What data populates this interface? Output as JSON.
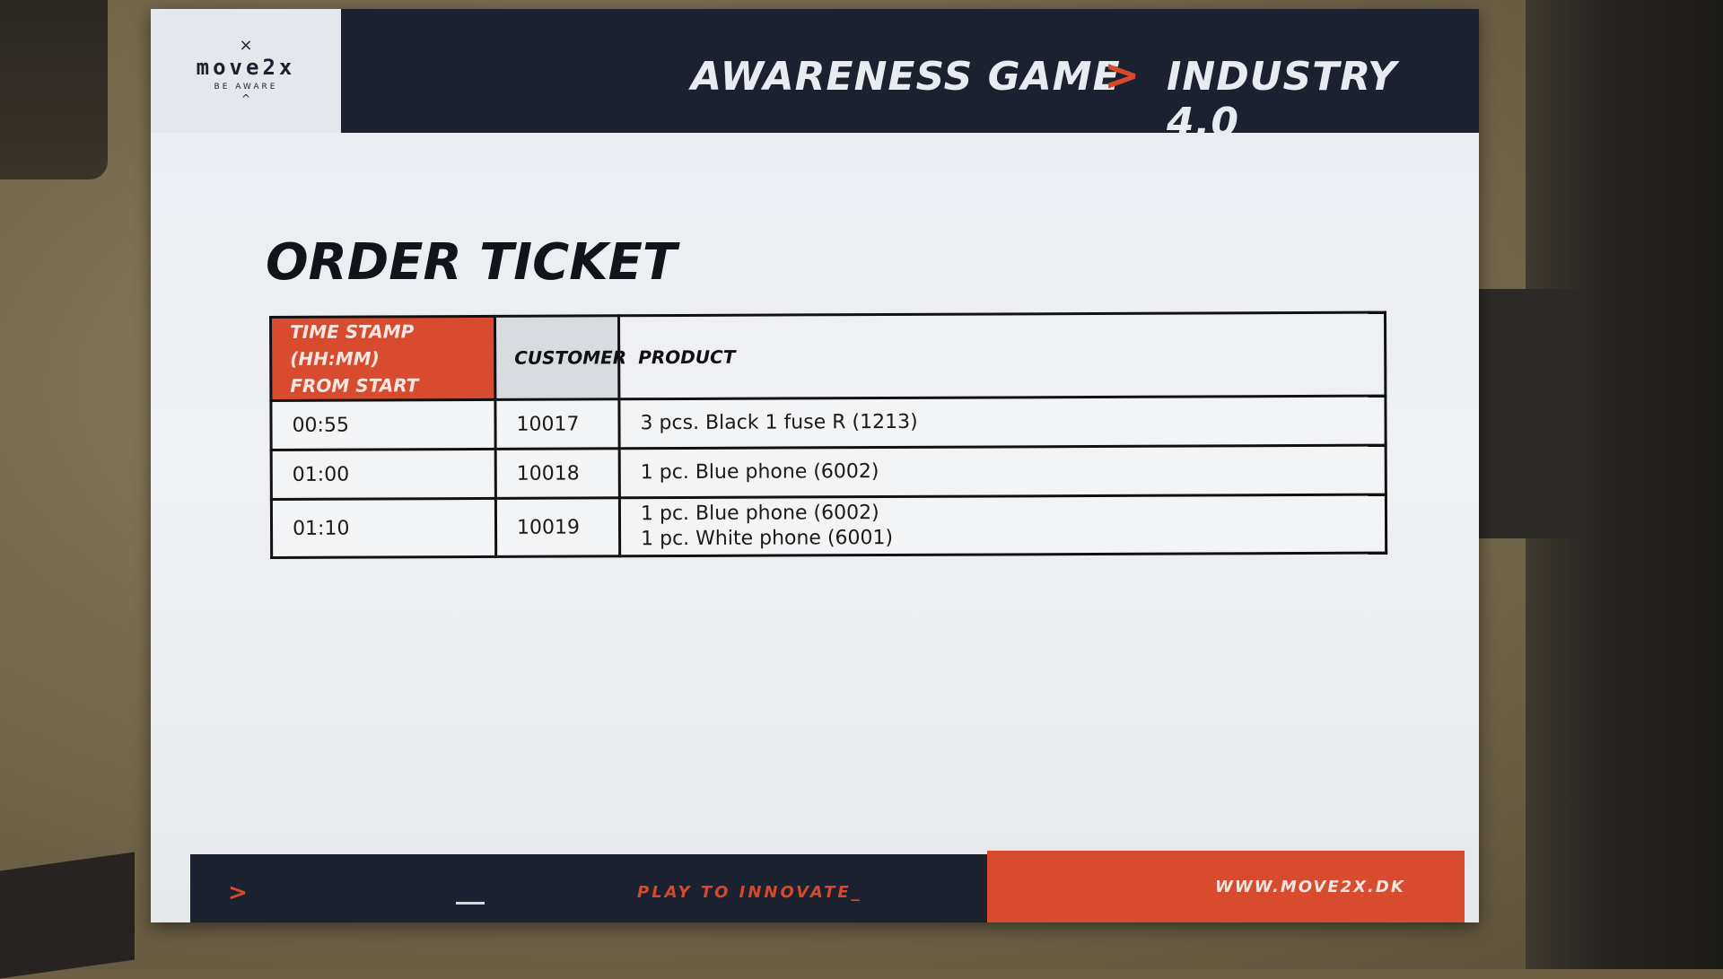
{
  "logo": {
    "mark": "×",
    "word": "move2x",
    "tagline": "BE AWARE",
    "caret": "^"
  },
  "header": {
    "left": "AWARENESS GAME",
    "separator": ">",
    "right": "INDUSTRY 4.0"
  },
  "title": "ORDER TICKET",
  "table": {
    "headers": {
      "time_line1": "TIME STAMP (HH:MM)",
      "time_line2": "FROM START",
      "customer": "CUSTOMER",
      "product": "PRODUCT"
    },
    "rows": [
      {
        "time": "00:55",
        "customer": "10017",
        "products": [
          "3 pcs. Black 1 fuse R (1213)"
        ]
      },
      {
        "time": "01:00",
        "customer": "10018",
        "products": [
          "1 pc. Blue phone (6002)"
        ]
      },
      {
        "time": "01:10",
        "customer": "10019",
        "products": [
          "1 pc. Blue phone (6002)",
          "1 pc. White phone (6001)"
        ]
      }
    ]
  },
  "footer": {
    "arrow": ">",
    "slogan": "PLAY TO INNOVATE_",
    "url": "WWW.MOVE2X.DK"
  },
  "colors": {
    "navy": "#1c2130",
    "accent_orange": "#d94b2e",
    "paper": "#eef0f3"
  }
}
